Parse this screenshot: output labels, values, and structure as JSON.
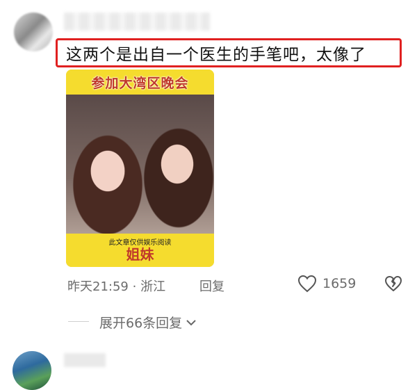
{
  "comment": {
    "text": "这两个是出自一个医生的手笔吧，太像了",
    "media": {
      "banner": "参加大湾区晚会",
      "caption_small": "此文章仅供娱乐阅读",
      "caption_big": "姐妹"
    },
    "time": "昨天21:59",
    "separator": "·",
    "location": "浙江",
    "reply_label": "回复",
    "likes": "1659",
    "expand_label": "展开66条回复"
  },
  "icons": {
    "like": "heart-outline-icon",
    "dislike": "broken-heart-icon",
    "expand": "chevron-down-icon"
  },
  "colors": {
    "highlight": "#e02020",
    "meta_text": "#6b6b6b",
    "media_yellow": "#f5dc2e"
  }
}
